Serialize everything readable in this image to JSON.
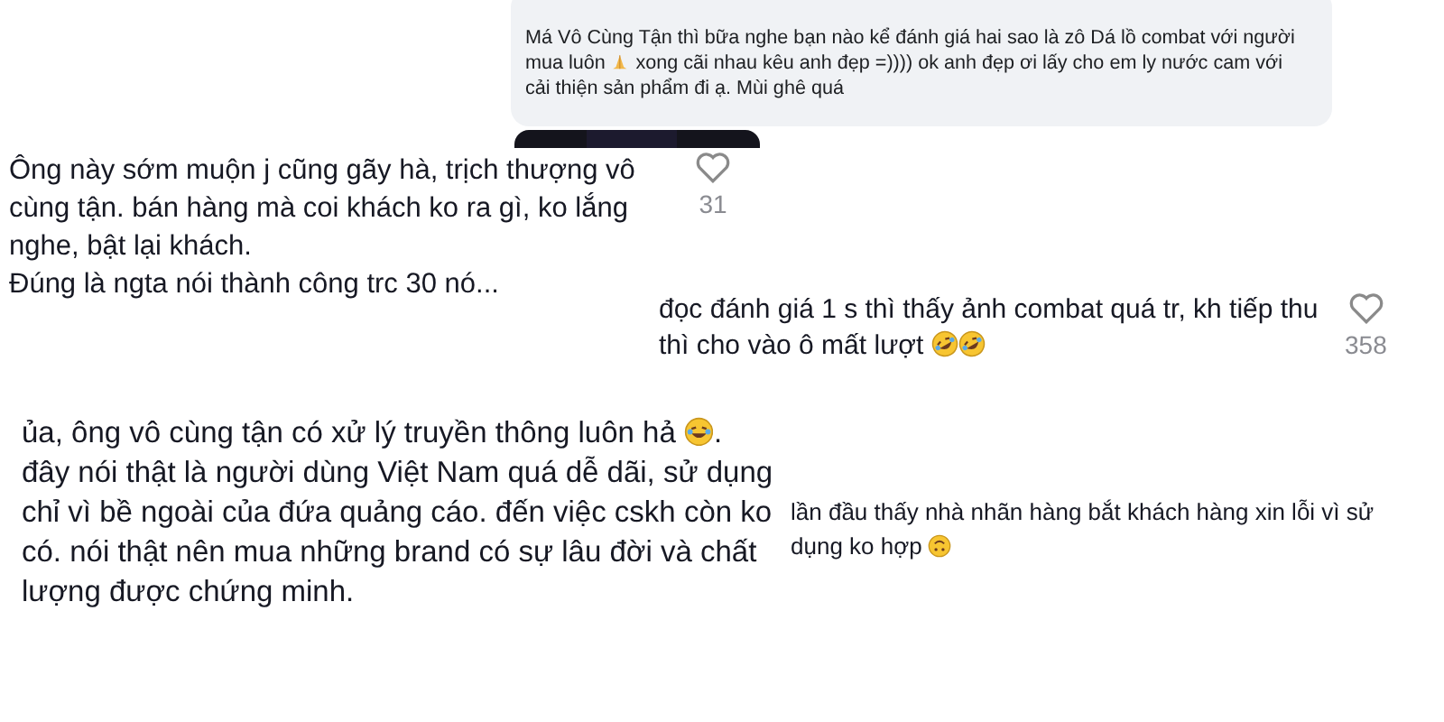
{
  "facebook_comment": {
    "parts": [
      {
        "kind": "text",
        "text": "Má Vô Cùng Tận thì bữa nghe bạn nào kể đánh giá hai sao là zô Dá lồ combat với người mua luôn "
      },
      {
        "kind": "pray"
      },
      {
        "kind": "text",
        "text": " xong cãi nhau kêu anh đẹp =)))) ok anh đẹp ơi lấy cho em ly nước cam với cải thiện sản phẩm đi ạ. Mùi ghê quá"
      }
    ]
  },
  "comments": [
    {
      "parts": [
        {
          "kind": "text",
          "text": "Ông này sớm muộn j cũng gãy hà, trịch thượng vô cùng tận. bán hàng mà coi khách ko ra gì, ko lắng nghe, bật lại khách.\nĐúng là ngta nói thành công trc 30 nó..."
        }
      ],
      "likes": "31"
    },
    {
      "parts": [
        {
          "kind": "text",
          "text": "đọc đánh giá 1 s thì thấy ảnh combat quá tr, kh tiếp thu thì cho vào ô mất lượt "
        },
        {
          "kind": "rofl"
        },
        {
          "kind": "rofl"
        }
      ],
      "likes": "358"
    },
    {
      "parts": [
        {
          "kind": "text",
          "text": "ủa, ông vô cùng tận có xử lý truyền thông luôn hả "
        },
        {
          "kind": "joy"
        },
        {
          "kind": "text",
          "text": ". đây nói thật là người dùng Việt Nam quá dễ dãi, sử dụng chỉ vì bề ngoài của đứa quảng cáo. đến việc cskh còn ko có. nói thật nên mua những brand có sự lâu đời và chất lượng được chứng minh."
        }
      ]
    },
    {
      "parts": [
        {
          "kind": "text",
          "text": "lần đầu thấy nhà nhãn hàng bắt khách hàng xin lỗi vì sử dụng ko hợp "
        },
        {
          "kind": "upside"
        }
      ]
    }
  ]
}
